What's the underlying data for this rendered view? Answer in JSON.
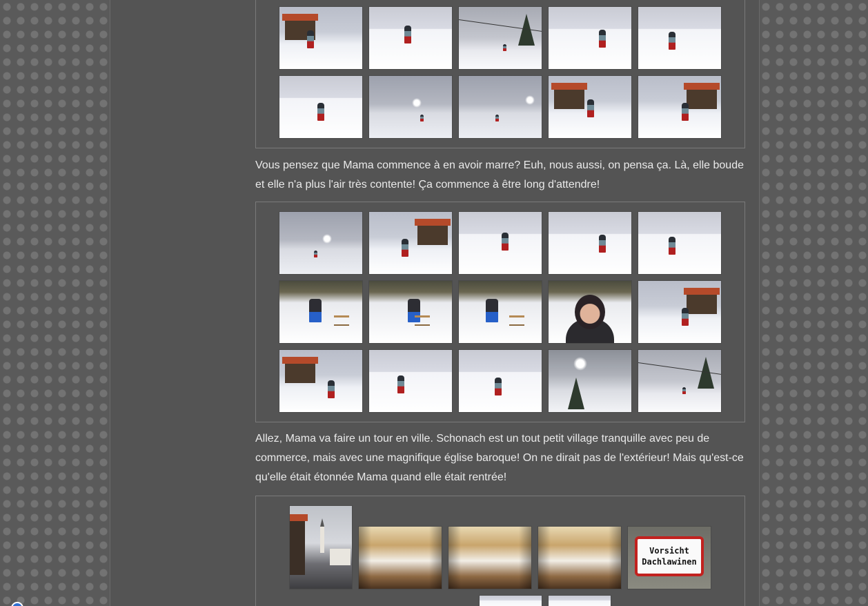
{
  "gallery_1": {
    "photos": [
      {
        "name": "photo-chalet-skier",
        "kind": "chalet"
      },
      {
        "name": "photo-skier-hill",
        "kind": "slope"
      },
      {
        "name": "photo-lift-pine",
        "kind": "lift"
      },
      {
        "name": "photo-skier-bent",
        "kind": "slope"
      },
      {
        "name": "photo-skier-poles",
        "kind": "slope"
      },
      {
        "name": "photo-skier-close",
        "kind": "slope"
      },
      {
        "name": "photo-fog-sun",
        "kind": "fog"
      },
      {
        "name": "photo-fog-sun-2",
        "kind": "fog"
      },
      {
        "name": "photo-village-orange",
        "kind": "chalet"
      },
      {
        "name": "photo-chalet-right",
        "kind": "chalet"
      }
    ]
  },
  "paragraph_1": "Vous pensez que Mama commence à en avoir marre? Euh, nous aussi, on pensa ça. Là, elle boude et elle n'a plus l'air très contente! Ça commence à être long d'attendre!",
  "gallery_2": {
    "photos": [
      {
        "name": "photo-fog-slope",
        "kind": "fog"
      },
      {
        "name": "photo-man-chalet",
        "kind": "chalet"
      },
      {
        "name": "photo-skier-left",
        "kind": "slope"
      },
      {
        "name": "photo-skier-mid",
        "kind": "slope"
      },
      {
        "name": "photo-skier-right",
        "kind": "slope"
      },
      {
        "name": "photo-sled-1",
        "kind": "sled"
      },
      {
        "name": "photo-sled-2",
        "kind": "sled"
      },
      {
        "name": "photo-sled-3",
        "kind": "sled"
      },
      {
        "name": "photo-portrait-smile",
        "kind": "face"
      },
      {
        "name": "photo-skier-village",
        "kind": "chalet"
      },
      {
        "name": "photo-skier-chalet-red",
        "kind": "chalet"
      },
      {
        "name": "photo-sledding-down",
        "kind": "slope"
      },
      {
        "name": "photo-fallen-skiers",
        "kind": "slope"
      },
      {
        "name": "photo-sun-tree",
        "kind": "sun"
      },
      {
        "name": "photo-chairlift",
        "kind": "lift"
      }
    ]
  },
  "paragraph_2": "Allez, Mama va faire un tour en ville. Schonach est un tout petit village tranquille avec peu de commerce, mais avec une magnifique église baroque! On ne dirait pas de l'extérieur! Mais qu'est-ce qu'elle était étonnée Mama quand elle était rentrée!",
  "gallery_3": {
    "sign_line_1": "Vorsicht",
    "sign_line_2": "Dachlawinen"
  }
}
